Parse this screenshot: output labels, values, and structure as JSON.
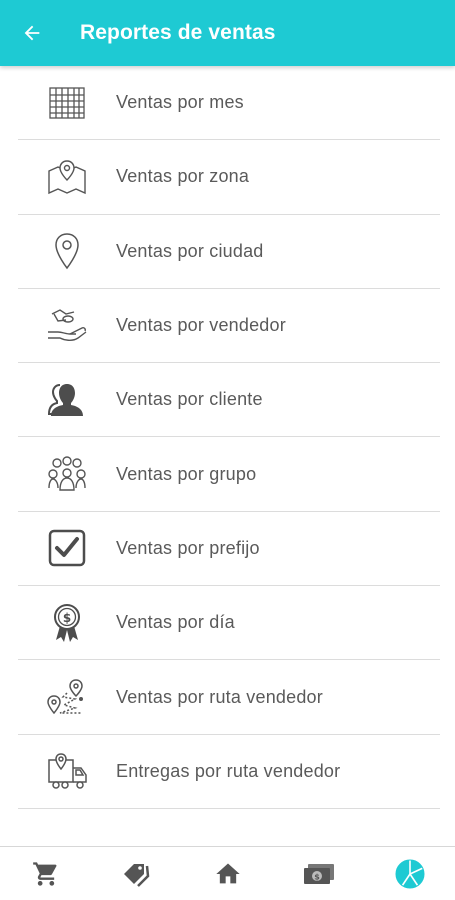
{
  "appbar": {
    "title": "Reportes de ventas",
    "back_icon": "arrow-back-icon",
    "color": "#1ecad3"
  },
  "reports": [
    {
      "label": "Ventas por mes",
      "icon": "calendar-grid-icon"
    },
    {
      "label": "Ventas por zona",
      "icon": "map-pin-icon"
    },
    {
      "label": "Ventas por ciudad",
      "icon": "location-pin-icon"
    },
    {
      "label": "Ventas por vendedor",
      "icon": "hand-coin-icon"
    },
    {
      "label": "Ventas por cliente",
      "icon": "person-icon"
    },
    {
      "label": "Ventas por grupo",
      "icon": "group-icon"
    },
    {
      "label": "Ventas por prefijo",
      "icon": "checkbox-icon"
    },
    {
      "label": "Ventas por día",
      "icon": "dollar-medal-icon"
    },
    {
      "label": "Ventas por ruta vendedor",
      "icon": "route-icon"
    },
    {
      "label": "Entregas por ruta vendedor",
      "icon": "delivery-truck-icon"
    }
  ],
  "bottom_nav": {
    "items": [
      {
        "icon": "cart-icon"
      },
      {
        "icon": "tags-icon"
      },
      {
        "icon": "home-icon"
      },
      {
        "icon": "cash-icon"
      },
      {
        "icon": "pie-chart-icon",
        "active": true
      }
    ],
    "active_color": "#1ecad3",
    "inactive_color": "#555555"
  }
}
